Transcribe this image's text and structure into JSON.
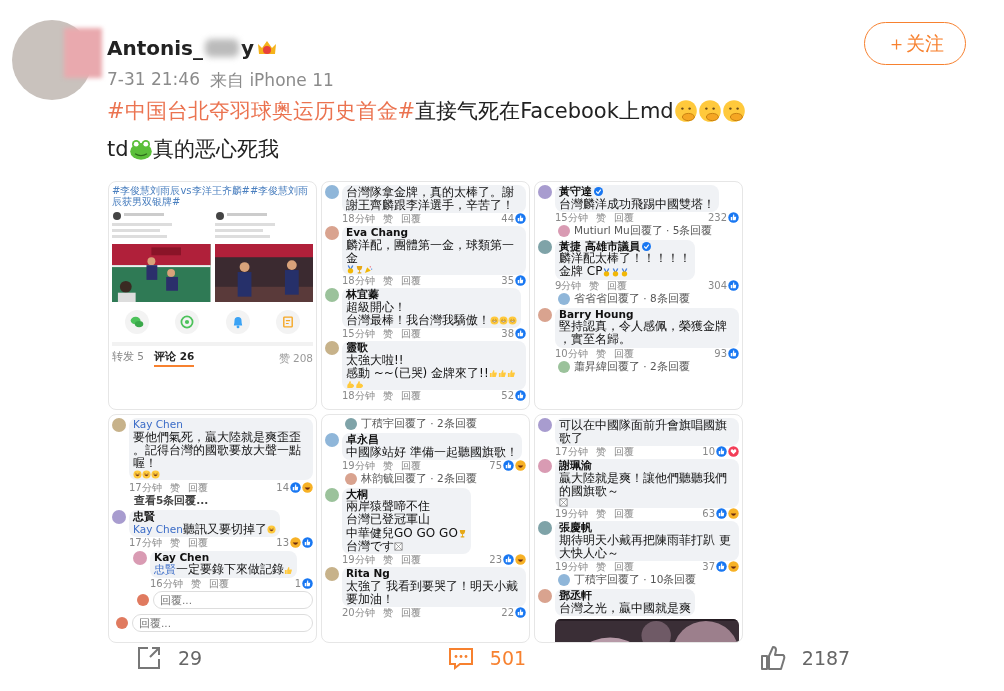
{
  "author": {
    "name_parts": [
      "Antonis_",
      "y"
    ]
  },
  "follow_button": "＋关注",
  "meta": {
    "time": "7-31 21:46",
    "source": "来自 iPhone 11"
  },
  "text_lines": [
    [
      {
        "kind": "hashtag",
        "text": "#中国台北夺羽球奥运历史首金#"
      },
      {
        "kind": "text",
        "text": "直接气死在Facebook上md"
      },
      {
        "kind": "face"
      },
      {
        "kind": "face"
      },
      {
        "kind": "face"
      }
    ],
    [
      {
        "kind": "text",
        "text": "td"
      },
      {
        "kind": "frog"
      },
      {
        "kind": "text",
        "text": "真的恶心死我"
      }
    ]
  ],
  "images": [
    {
      "kind": "post",
      "title": "#李俊慧刘雨辰vs李洋王齐麟##李俊慧刘雨辰获男双银牌#",
      "embeds": [
        {
          "kind": "picture"
        },
        {
          "kind": "picture"
        }
      ],
      "share_targets": [
        {
          "kind": "chat"
        },
        {
          "kind": "aperture"
        },
        {
          "kind": "bell"
        },
        {
          "kind": "document"
        }
      ],
      "tabs": [
        {
          "label": "转发 5",
          "selected": false
        },
        {
          "label": "评论 26",
          "selected": true
        }
      ],
      "likes": "赞 208"
    },
    {
      "kind": "comments",
      "items": [
        {
          "kind": "comment",
          "lines": [
            [
              {
                "kind": "text",
                "text": "台灣隊拿金牌，真的太棒了。謝謝王齊麟跟李洋選手，辛苦了！"
              }
            ]
          ],
          "time": "18分钟",
          "actions": [
            "赞",
            "回覆"
          ],
          "count": "44",
          "reactions": [
            {
              "kind": "like"
            }
          ]
        },
        {
          "kind": "comment",
          "author": "Eva Chang",
          "lines": [
            [
              {
                "kind": "text",
                "text": "麟洋配，團體第一金，球類第一金"
              },
              {
                "kind": "medal"
              },
              {
                "kind": "trophy"
              },
              {
                "kind": "party"
              }
            ]
          ],
          "time": "18分钟",
          "actions": [
            "赞",
            "回覆"
          ],
          "count": "35",
          "reactions": [
            {
              "kind": "like"
            }
          ]
        },
        {
          "kind": "comment",
          "author": "林宜蓁",
          "lines": [
            [
              {
                "kind": "text",
                "text": "超級開心！"
              }
            ],
            [
              {
                "kind": "text",
                "text": "台灣最棒！我台灣我驕傲！"
              },
              {
                "kind": "grin"
              },
              {
                "kind": "grin"
              },
              {
                "kind": "grin"
              }
            ]
          ],
          "time": "15分钟",
          "actions": [
            "赞",
            "回覆"
          ],
          "count": "38",
          "reactions": [
            {
              "kind": "like"
            }
          ]
        },
        {
          "kind": "comment",
          "author": "靈歌",
          "lines": [
            [
              {
                "kind": "text",
                "text": "太強大啦!!"
              }
            ],
            [
              {
                "kind": "text",
                "text": "感動 ~~(已哭) 金牌來了!!"
              },
              {
                "kind": "thumb"
              },
              {
                "kind": "thumb"
              },
              {
                "kind": "thumb"
              },
              {
                "kind": "muscle"
              },
              {
                "kind": "muscle"
              }
            ]
          ],
          "time": "18分钟",
          "actions": [
            "赞",
            "回覆"
          ],
          "count": "52",
          "reactions": [
            {
              "kind": "like"
            }
          ]
        }
      ]
    },
    {
      "kind": "comments",
      "items": [
        {
          "kind": "comment",
          "author": "黃守達",
          "verified": true,
          "lines": [
            [
              {
                "kind": "text",
                "text": "台灣麟洋成功飛踢中國雙塔！"
              }
            ]
          ],
          "time": "15分钟",
          "actions": [
            "赞",
            "回覆"
          ],
          "count": "232",
          "reactions": [
            {
              "kind": "like"
            }
          ]
        },
        {
          "kind": "replies",
          "text": "Mutiurl Mu回覆了 · 5条回覆"
        },
        {
          "kind": "comment",
          "author": "黃捷 高雄市議員",
          "verified": true,
          "lines": [
            [
              {
                "kind": "text",
                "text": "麟洋配太棒了！！！！！"
              }
            ],
            [
              {
                "kind": "text",
                "text": "金牌 CP"
              },
              {
                "kind": "medal"
              },
              {
                "kind": "medal"
              },
              {
                "kind": "medal"
              }
            ]
          ],
          "time": "9分钟",
          "actions": [
            "赞",
            "回覆"
          ],
          "count": "304",
          "reactions": [
            {
              "kind": "like"
            }
          ]
        },
        {
          "kind": "replies",
          "text": "省省省回覆了 · 8条回覆"
        },
        {
          "kind": "comment",
          "author": "Barry Houng",
          "lines": [
            [
              {
                "kind": "text",
                "text": "堅持認真，令人感佩，榮獲金牌，實至名歸。"
              }
            ]
          ],
          "time": "10分钟",
          "actions": [
            "赞",
            "回覆"
          ],
          "count": "93",
          "reactions": [
            {
              "kind": "like"
            }
          ]
        },
        {
          "kind": "replies",
          "text": "蕭昇緯回覆了 · 2条回覆"
        }
      ]
    },
    {
      "kind": "comments",
      "items": [
        {
          "kind": "comment",
          "lines": [
            [
              {
                "kind": "mention",
                "text": "Kay Chen"
              },
              {
                "kind": "text",
                "text": " 要他們氣死，贏大陸就是爽歪歪。記得台灣的國歌要放大聲一點喔！"
              }
            ],
            [
              {
                "kind": "laugh"
              },
              {
                "kind": "laugh"
              },
              {
                "kind": "laugh"
              }
            ]
          ],
          "time": "17分钟",
          "actions": [
            "赞",
            "回覆"
          ],
          "count": "14",
          "reactions": [
            {
              "kind": "like"
            },
            {
              "kind": "haha"
            }
          ]
        },
        {
          "kind": "more",
          "text": "查看5条回覆..."
        },
        {
          "kind": "comment",
          "author": "忠賢",
          "lines": [
            [
              {
                "kind": "mention",
                "text": "Kay Chen"
              },
              {
                "kind": "text",
                "text": " 聽訊又要切掉了"
              },
              {
                "kind": "laugh"
              }
            ]
          ],
          "time": "17分钟",
          "actions": [
            "赞",
            "回覆"
          ],
          "count": "13",
          "reactions": [
            {
              "kind": "haha"
            },
            {
              "kind": "like"
            }
          ],
          "children": [
            {
              "kind": "comment",
              "author": "Kay Chen",
              "lines": [
                [
                  {
                    "kind": "mention",
                    "text": "忠賢"
                  },
                  {
                    "kind": "text",
                    "text": " 一定要錄下來做記錄"
                  },
                  {
                    "kind": "thumb"
                  }
                ]
              ],
              "time": "16分钟",
              "actions": [
                "赞",
                "回覆"
              ],
              "count": "1",
              "reactions": [
                {
                  "kind": "like"
                }
              ]
            },
            {
              "kind": "reply_field",
              "placeholder": "回覆..."
            }
          ]
        },
        {
          "kind": "reply_field",
          "placeholder": "回覆..."
        }
      ]
    },
    {
      "kind": "comments",
      "items": [
        {
          "kind": "replies",
          "text": "丁積宇回覆了 · 2条回覆"
        },
        {
          "kind": "comment",
          "author": "卓永昌",
          "lines": [
            [
              {
                "kind": "text",
                "text": "中國隊站好 準備一起聽國旗歌！"
              }
            ]
          ],
          "time": "19分钟",
          "actions": [
            "赞",
            "回覆"
          ],
          "count": "75",
          "reactions": [
            {
              "kind": "like"
            },
            {
              "kind": "haha"
            }
          ]
        },
        {
          "kind": "replies",
          "text": "林韵毓回覆了 · 2条回覆"
        },
        {
          "kind": "comment",
          "author": "大桐",
          "lines": [
            [
              {
                "kind": "text",
                "text": "兩岸猿聲啼不住"
              }
            ],
            [
              {
                "kind": "text",
                "text": "台灣已登冠軍山"
              }
            ],
            [
              {
                "kind": "text",
                "text": "中華健兒GO GO GO"
              },
              {
                "kind": "trophy"
              }
            ],
            [
              {
                "kind": "text",
                "text": "台灣です"
              },
              {
                "kind": "box"
              }
            ]
          ],
          "time": "19分钟",
          "actions": [
            "赞",
            "回覆"
          ],
          "count": "23",
          "reactions": [
            {
              "kind": "like"
            },
            {
              "kind": "haha"
            }
          ]
        },
        {
          "kind": "comment",
          "author": "Rita Ng",
          "lines": [
            [
              {
                "kind": "text",
                "text": "太強了 我看到要哭了！明天小戴要加油！"
              }
            ]
          ],
          "time": "20分钟",
          "actions": [
            "赞",
            "回覆"
          ],
          "count": "22",
          "reactions": [
            {
              "kind": "like"
            }
          ]
        }
      ]
    },
    {
      "kind": "comments",
      "items": [
        {
          "kind": "comment",
          "lines": [
            [
              {
                "kind": "text",
                "text": "可以在中國隊面前升會旗唱國旗歌了"
              }
            ]
          ],
          "time": "17分钟",
          "actions": [
            "赞",
            "回覆"
          ],
          "count": "10",
          "reactions": [
            {
              "kind": "like"
            },
            {
              "kind": "love"
            }
          ]
        },
        {
          "kind": "comment",
          "author": "謝珮渝",
          "lines": [
            [
              {
                "kind": "text",
                "text": "贏大陸就是爽！讓他們聽聽我們的國旗歌～"
              },
              {
                "kind": "box"
              }
            ]
          ],
          "time": "19分钟",
          "actions": [
            "赞",
            "回覆"
          ],
          "count": "63",
          "reactions": [
            {
              "kind": "like"
            },
            {
              "kind": "haha"
            }
          ]
        },
        {
          "kind": "comment",
          "author": "張慶帆",
          "lines": [
            [
              {
                "kind": "text",
                "text": "期待明天小戴再把陳雨菲打趴 更大快人心～"
              }
            ]
          ],
          "time": "19分钟",
          "actions": [
            "赞",
            "回覆"
          ],
          "count": "37",
          "reactions": [
            {
              "kind": "like"
            },
            {
              "kind": "haha"
            }
          ]
        },
        {
          "kind": "replies",
          "text": "丁積宇回覆了 · 10条回覆"
        },
        {
          "kind": "comment",
          "author": "鄧丞軒",
          "lines": [
            [
              {
                "kind": "text",
                "text": "台灣之光，贏中國就是爽"
              }
            ]
          ],
          "media": {
            "kind": "picture"
          }
        }
      ]
    }
  ],
  "actions": [
    {
      "kind": "share",
      "count": "29",
      "selected": false
    },
    {
      "kind": "comment",
      "count": "501",
      "selected": true
    },
    {
      "kind": "like",
      "count": "2187",
      "selected": false
    }
  ]
}
